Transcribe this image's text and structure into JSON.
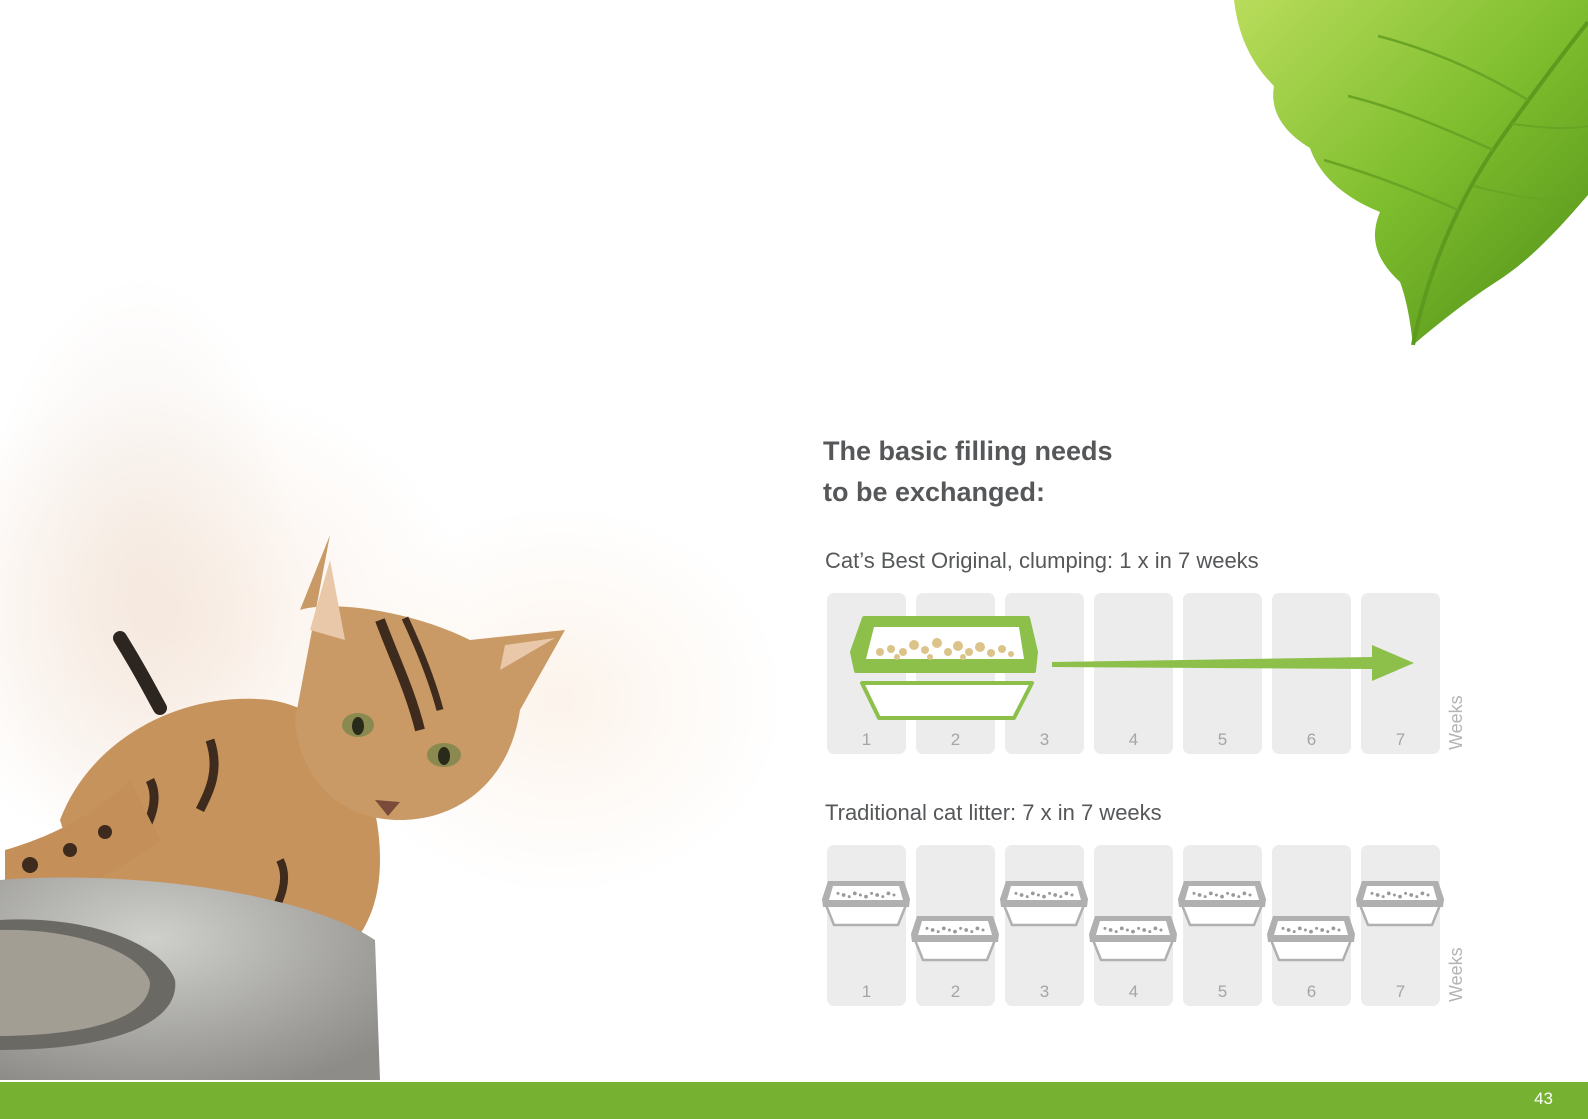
{
  "heading": {
    "line1": "The basic filling needs",
    "line2": "to be exchanged:"
  },
  "comparison": {
    "axis_label": "Weeks",
    "cats_best": {
      "label": "Cat’s Best Original, clumping: 1 x in 7 weeks",
      "weeks": [
        "1",
        "2",
        "3",
        "4",
        "5",
        "6",
        "7"
      ],
      "exchanges_per_7_weeks": 1
    },
    "traditional": {
      "label": "Traditional cat litter: 7 x in 7 weeks",
      "weeks": [
        "1",
        "2",
        "3",
        "4",
        "5",
        "6",
        "7"
      ],
      "exchanges_per_7_weeks": 7
    }
  },
  "colors": {
    "brand_green": "#76b132",
    "tray_green": "#8cc04b",
    "litter_beige": "#dcc38a",
    "tray_grey": "#b0b0b0",
    "text_grey": "#555759"
  },
  "page_number": "43"
}
